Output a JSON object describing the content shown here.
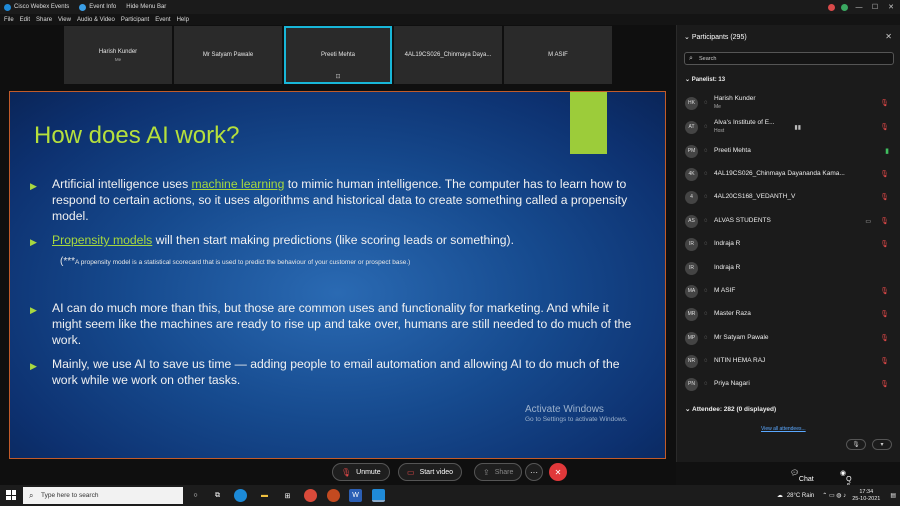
{
  "titlebar": {
    "app_name": "Cisco Webex Events",
    "event_info": "Event Info",
    "hide_menu": "Hide Menu Bar",
    "min": "—",
    "max": "☐",
    "close": "✕"
  },
  "menu": {
    "items": [
      "File",
      "Edit",
      "Share",
      "View",
      "Audio & Video",
      "Participant",
      "Event",
      "Help"
    ]
  },
  "thumbnails": [
    {
      "name": "Harish Kunder",
      "sub": "Me"
    },
    {
      "name": "Mr Satyam Pawale",
      "sub": ""
    },
    {
      "name": "Preeti Mehta",
      "sub": ""
    },
    {
      "name": "4AL19CS026_Chinmaya Daya...",
      "sub": ""
    },
    {
      "name": "M ASIF",
      "sub": ""
    }
  ],
  "slide": {
    "title": "How does AI work?",
    "b1_pre": "Artificial intelligence uses ",
    "b1_link": "machine learning",
    "b1_post": " to mimic human intelligence. The computer has to learn how to respond to certain actions, so it uses algorithms and historical data to create something called a propensity model.",
    "b2_link": "Propensity models",
    "b2_post": " will then start making predictions (like scoring leads or something).",
    "note_prefix": "(***",
    "note_text": "A propensity model is a statistical scorecard that is used to predict the behaviour of your customer or prospect base.)",
    "b3": "AI can do much more than this, but those are common uses and functionality for marketing. And while it might seem like the machines are ready to rise up and take over, humans are still needed to do much of the work.",
    "b4": "Mainly, we use AI to save us time — adding people to email automation and allowing AI to do much of the work while we work on other tasks.",
    "watermark_title": "Activate Windows",
    "watermark_sub": "Go to Settings to activate Windows."
  },
  "controls": {
    "unmute": "Unmute",
    "start_video": "Start video",
    "share": "Share",
    "more": "···",
    "end": "✕",
    "chat": "Chat",
    "qa": "Q & A"
  },
  "panel": {
    "title": "Participants (295)",
    "search_placeholder": "Search",
    "panelist_header": "Panelist: 13",
    "attendee_header": "Attendee: 282 (0 displayed)",
    "view_all": "View all attendees...",
    "panelists": [
      {
        "initials": "HK",
        "name": "Harish Kunder",
        "sub": "Me",
        "mic": "muted"
      },
      {
        "initials": "AT",
        "name": "Alva's Institute of E...",
        "sub": "Host",
        "mic": "muted"
      },
      {
        "initials": "PM",
        "name": "Preeti Mehta",
        "sub": "",
        "mic": "on"
      },
      {
        "initials": "4K",
        "name": "4AL19CS026_Chinmaya Dayananda Kama...",
        "sub": "",
        "mic": "muted"
      },
      {
        "initials": "4",
        "name": "4AL20CS168_VEDANTH_V",
        "sub": "",
        "mic": "muted"
      },
      {
        "initials": "AS",
        "name": "ALVAS STUDENTS",
        "sub": "",
        "mic": "muted"
      },
      {
        "initials": "IR",
        "name": "Indraja R",
        "sub": "",
        "mic": "muted"
      },
      {
        "initials": "IR",
        "name": "Indraja R",
        "sub": "",
        "mic": "none"
      },
      {
        "initials": "MA",
        "name": "M ASIF",
        "sub": "",
        "mic": "muted"
      },
      {
        "initials": "MR",
        "name": "Master Raza",
        "sub": "",
        "mic": "muted"
      },
      {
        "initials": "MP",
        "name": "Mr Satyam Pawale",
        "sub": "",
        "mic": "muted"
      },
      {
        "initials": "NR",
        "name": "NITIN HEMA RAJ",
        "sub": "",
        "mic": "muted"
      },
      {
        "initials": "PN",
        "name": "Priya Nagari",
        "sub": "",
        "mic": "muted"
      }
    ]
  },
  "taskbar": {
    "search_placeholder": "Type here to search",
    "weather": "28°C  Rain",
    "time": "17:34",
    "date": "25-10-2021"
  },
  "colors": {
    "accent_cyan": "#18b6d8",
    "slide_green": "#b6e03c",
    "end_red": "#e0383a"
  }
}
